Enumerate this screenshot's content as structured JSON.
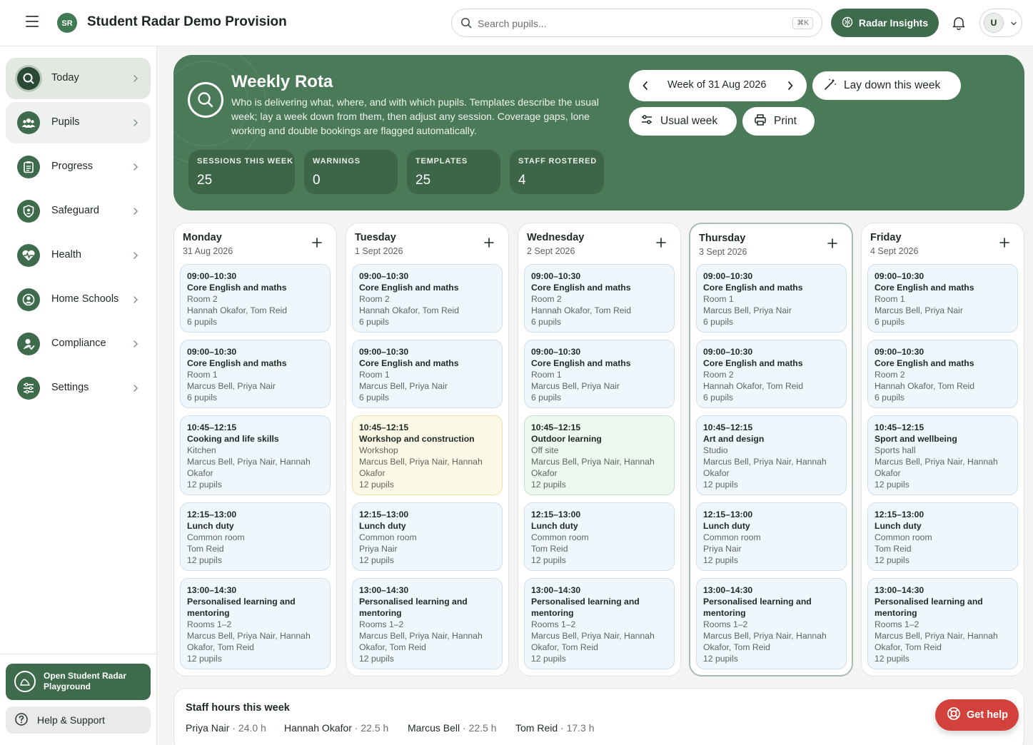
{
  "app": {
    "title": "Student Radar Demo Provision"
  },
  "search": {
    "placeholder": "Search pupils...",
    "shortcut": "⌘K"
  },
  "header": {
    "insights_label": "Radar Insights",
    "avatar_initial": "U"
  },
  "sidebar": {
    "items": [
      {
        "label": "Today",
        "icon": "search-icon",
        "state": "active"
      },
      {
        "label": "Pupils",
        "icon": "users-icon",
        "state": "hover"
      },
      {
        "label": "Progress",
        "icon": "clipboard-icon"
      },
      {
        "label": "Safeguard",
        "icon": "shield-icon"
      },
      {
        "label": "Health",
        "icon": "heart-pulse-icon"
      },
      {
        "label": "Home Schools",
        "icon": "user-circle-icon"
      },
      {
        "label": "Compliance",
        "icon": "user-check-icon"
      },
      {
        "label": "Settings",
        "icon": "sliders-icon"
      }
    ],
    "playground_label": "Open Student Radar Playground",
    "help_label": "Help & Support"
  },
  "rota": {
    "title": "Weekly Rota",
    "description": "Who is delivering what, where, and with which pupils. Templates describe the usual week; lay a week down from them, then adjust any session. Coverage gaps, lone working and double bookings are flagged automatically.",
    "week_label": "Week of 31 Aug 2026",
    "lay_down_label": "Lay down this week",
    "usual_week_label": "Usual week",
    "print_label": "Print",
    "stats": [
      {
        "label": "SESSIONS THIS WEEK",
        "value": "25"
      },
      {
        "label": "WARNINGS",
        "value": "0"
      },
      {
        "label": "TEMPLATES",
        "value": "25"
      },
      {
        "label": "STAFF ROSTERED",
        "value": "4"
      }
    ]
  },
  "days": [
    {
      "name": "Monday",
      "date": "31 Aug 2026",
      "sessions": [
        {
          "time": "09:00–10:30",
          "title": "Core English and maths",
          "room": "Room 2",
          "staff": "Hannah Okafor, Tom Reid",
          "pupils": "6 pupils"
        },
        {
          "time": "09:00–10:30",
          "title": "Core English and maths",
          "room": "Room 1",
          "staff": "Marcus Bell, Priya Nair",
          "pupils": "6 pupils"
        },
        {
          "time": "10:45–12:15",
          "title": "Cooking and life skills",
          "room": "Kitchen",
          "staff": "Marcus Bell, Priya Nair, Hannah Okafor",
          "pupils": "12 pupils"
        },
        {
          "time": "12:15–13:00",
          "title": "Lunch duty",
          "room": "Common room",
          "staff": "Tom Reid",
          "pupils": "12 pupils"
        },
        {
          "time": "13:00–14:30",
          "title": "Personalised learning and mentoring",
          "room": "Rooms 1–2",
          "staff": "Marcus Bell, Priya Nair, Hannah Okafor, Tom Reid",
          "pupils": "12 pupils"
        }
      ]
    },
    {
      "name": "Tuesday",
      "date": "1 Sept 2026",
      "sessions": [
        {
          "time": "09:00–10:30",
          "title": "Core English and maths",
          "room": "Room 2",
          "staff": "Hannah Okafor, Tom Reid",
          "pupils": "6 pupils"
        },
        {
          "time": "09:00–10:30",
          "title": "Core English and maths",
          "room": "Room 1",
          "staff": "Marcus Bell, Priya Nair",
          "pupils": "6 pupils"
        },
        {
          "time": "10:45–12:15",
          "title": "Workshop and construction",
          "room": "Workshop",
          "staff": "Marcus Bell, Priya Nair, Hannah Okafor",
          "pupils": "12 pupils"
        },
        {
          "time": "12:15–13:00",
          "title": "Lunch duty",
          "room": "Common room",
          "staff": "Priya Nair",
          "pupils": "12 pupils"
        },
        {
          "time": "13:00–14:30",
          "title": "Personalised learning and mentoring",
          "room": "Rooms 1–2",
          "staff": "Marcus Bell, Priya Nair, Hannah Okafor, Tom Reid",
          "pupils": "12 pupils"
        }
      ]
    },
    {
      "name": "Wednesday",
      "date": "2 Sept 2026",
      "sessions": [
        {
          "time": "09:00–10:30",
          "title": "Core English and maths",
          "room": "Room 2",
          "staff": "Hannah Okafor, Tom Reid",
          "pupils": "6 pupils"
        },
        {
          "time": "09:00–10:30",
          "title": "Core English and maths",
          "room": "Room 1",
          "staff": "Marcus Bell, Priya Nair",
          "pupils": "6 pupils"
        },
        {
          "time": "10:45–12:15",
          "title": "Outdoor learning",
          "room": "Off site",
          "staff": "Marcus Bell, Priya Nair, Hannah Okafor",
          "pupils": "12 pupils"
        },
        {
          "time": "12:15–13:00",
          "title": "Lunch duty",
          "room": "Common room",
          "staff": "Tom Reid",
          "pupils": "12 pupils"
        },
        {
          "time": "13:00–14:30",
          "title": "Personalised learning and mentoring",
          "room": "Rooms 1–2",
          "staff": "Marcus Bell, Priya Nair, Hannah Okafor, Tom Reid",
          "pupils": "12 pupils"
        }
      ]
    },
    {
      "name": "Thursday",
      "date": "3 Sept 2026",
      "sessions": [
        {
          "time": "09:00–10:30",
          "title": "Core English and maths",
          "room": "Room 1",
          "staff": "Marcus Bell, Priya Nair",
          "pupils": "6 pupils"
        },
        {
          "time": "09:00–10:30",
          "title": "Core English and maths",
          "room": "Room 2",
          "staff": "Hannah Okafor, Tom Reid",
          "pupils": "6 pupils"
        },
        {
          "time": "10:45–12:15",
          "title": "Art and design",
          "room": "Studio",
          "staff": "Marcus Bell, Priya Nair, Hannah Okafor",
          "pupils": "12 pupils"
        },
        {
          "time": "12:15–13:00",
          "title": "Lunch duty",
          "room": "Common room",
          "staff": "Priya Nair",
          "pupils": "12 pupils"
        },
        {
          "time": "13:00–14:30",
          "title": "Personalised learning and mentoring",
          "room": "Rooms 1–2",
          "staff": "Marcus Bell, Priya Nair, Hannah Okafor, Tom Reid",
          "pupils": "12 pupils"
        }
      ]
    },
    {
      "name": "Friday",
      "date": "4 Sept 2026",
      "sessions": [
        {
          "time": "09:00–10:30",
          "title": "Core English and maths",
          "room": "Room 1",
          "staff": "Marcus Bell, Priya Nair",
          "pupils": "6 pupils"
        },
        {
          "time": "09:00–10:30",
          "title": "Core English and maths",
          "room": "Room 2",
          "staff": "Hannah Okafor, Tom Reid",
          "pupils": "6 pupils"
        },
        {
          "time": "10:45–12:15",
          "title": "Sport and wellbeing",
          "room": "Sports hall",
          "staff": "Marcus Bell, Priya Nair, Hannah Okafor",
          "pupils": "12 pupils"
        },
        {
          "time": "12:15–13:00",
          "title": "Lunch duty",
          "room": "Common room",
          "staff": "Tom Reid",
          "pupils": "12 pupils"
        },
        {
          "time": "13:00–14:30",
          "title": "Personalised learning and mentoring",
          "room": "Rooms 1–2",
          "staff": "Marcus Bell, Priya Nair, Hannah Okafor, Tom Reid",
          "pupils": "12 pupils"
        }
      ]
    }
  ],
  "staff_hours": {
    "title": "Staff hours this week",
    "entries": [
      {
        "name": "Priya Nair",
        "hours": "· 24.0 h"
      },
      {
        "name": "Hannah Okafor",
        "hours": "· 22.5 h"
      },
      {
        "name": "Marcus Bell",
        "hours": "· 22.5 h"
      },
      {
        "name": "Tom Reid",
        "hours": "· 17.3 h"
      }
    ]
  },
  "get_help_label": "Get help",
  "colors": {
    "brand": "#3e6b4c",
    "hero": "#4a7a57",
    "alert": "#d2413c",
    "session_default": "#f0f7fc",
    "session_workshop": "#fcf8e6",
    "session_outdoor": "#edf8f0"
  }
}
